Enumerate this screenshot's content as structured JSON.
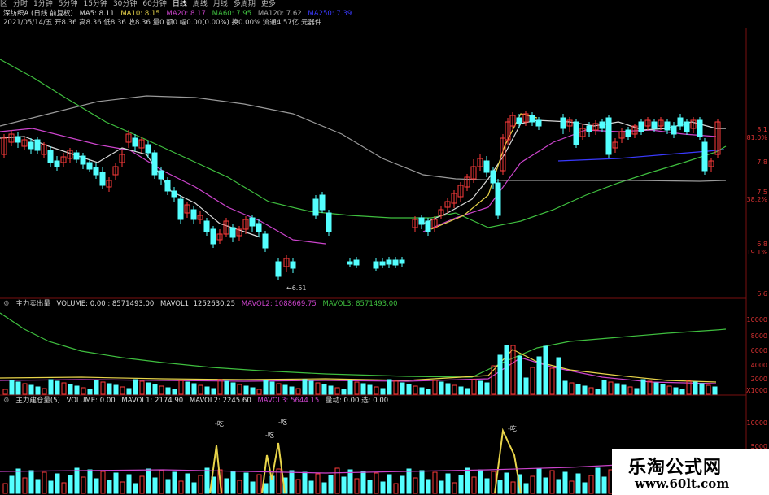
{
  "toolbar": {
    "items": [
      "区",
      "分时",
      "1分钟",
      "5分钟",
      "15分钟",
      "30分钟",
      "60分钟",
      "日线",
      "周线",
      "月线",
      "多周期",
      "更多"
    ],
    "active_index": 7
  },
  "main_header": {
    "title": "深纺织A (日线 前复权)",
    "ma5": "MA5: 8.11",
    "ma10": "MA10: 8.15",
    "ma20": "MA20: 8.17",
    "ma60": "MA60: 7.95",
    "ma120": "MA120: 7.62",
    "ma250_label": "MA250: 7.39",
    "info": "2021/05/14/五 开8.36 高8.36 低8.36 收8.36 量0 额0 幅0.00(0.00%) 换0.00% 流通4.57亿 元器件"
  },
  "main_axis": [
    "8.1",
    "81.0%",
    "7.8",
    "7.5",
    "38.2%",
    "6.8",
    "19.1%",
    "6.6"
  ],
  "main_low_label": "6.51",
  "vol1_header": {
    "name": "主力卖出量",
    "volume": "VOLUME: 0.00 : 8571493.00",
    "mavol1": "MAVOL1: 1252630.25",
    "mavol2": "MAVOL2: 1088669.75",
    "mavol3": "MAVOL3: 8571493.00"
  },
  "vol1_axis": [
    "10000",
    "8000",
    "6000",
    "4000",
    "2000",
    "X1000"
  ],
  "vol2_header": {
    "name": "主力建仓量(5)",
    "volume": "VOLUME: 0.00",
    "mavol1": "MAVOL1: 2174.90",
    "mavol2": "MAVOL2: 2245.60",
    "mavol3": "MAVOL3: 5644.15",
    "extra": "量动: 0.00  选: 0.00"
  },
  "vol2_axis": [
    "10000",
    "5000"
  ],
  "vol2_annotations": [
    "-吃",
    "-吃",
    "-吃",
    "-吃"
  ],
  "brand": {
    "name": "乐淘公式网",
    "url": "www.60lt.com"
  },
  "colors": {
    "up": "#ff3b3b",
    "down": "#54ffff",
    "ma_white": "#d8d8d8",
    "ma_yellow": "#e8d44a",
    "ma_magenta": "#cc44cc",
    "ma_green": "#3fbf3f",
    "ma_gray": "#9a9a9a",
    "trend_blue": "#3a3aff",
    "axis": "#7a1010"
  }
}
